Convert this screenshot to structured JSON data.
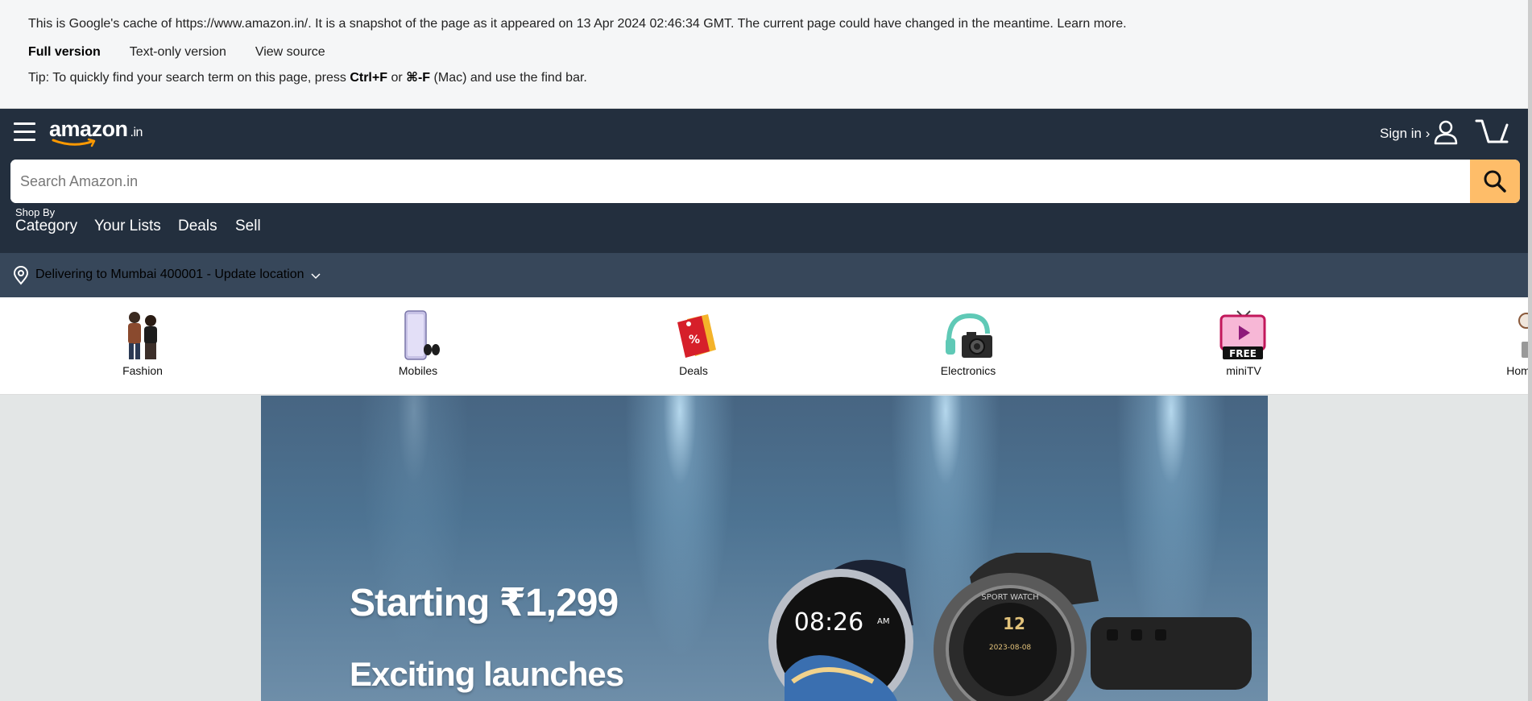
{
  "cache_banner": {
    "notice": "This is Google's cache of https://www.amazon.in/. It is a snapshot of the page as it appeared on 13 Apr 2024 02:46:34 GMT. The current page could have changed in the meantime.",
    "learn_more": "Learn more.",
    "versions": [
      "Full version",
      "Text-only version",
      "View source"
    ],
    "tip_prefix": "Tip: To quickly find your search term on this page, press",
    "tip_key1": "Ctrl+F",
    "tip_or": "or",
    "tip_key2": "⌘-F",
    "tip_suffix": "(Mac) and use the find bar."
  },
  "header": {
    "logo_text": "amazon",
    "logo_tld": ".in",
    "signin_label": "Sign in ›",
    "search_placeholder": "Search Amazon.in"
  },
  "subnav": {
    "shop_by": "Shop By",
    "items": [
      "Category",
      "Your Lists",
      "Deals",
      "Sell"
    ]
  },
  "delivery": {
    "text": "Delivering to Mumbai 400001 - Update location"
  },
  "categories": [
    {
      "label": "Fashion",
      "icon": "fashion-icon"
    },
    {
      "label": "Mobiles",
      "icon": "mobile-phone-icon"
    },
    {
      "label": "Deals",
      "icon": "discount-tag-icon"
    },
    {
      "label": "Electronics",
      "icon": "camera-headphones-icon"
    },
    {
      "label": "miniTV",
      "icon": "tv-free-icon"
    },
    {
      "label": "Hom",
      "icon": "home-appliances-icon"
    }
  ],
  "minitv_badge": "FREE",
  "deals_badge": "%",
  "hero": {
    "title": "Starting ₹1,299",
    "subtitle": "Exciting launches",
    "watch_time": "08:26",
    "watch_ampm": "AM",
    "watch2_brand": "SPORT WATCH",
    "watch2_number": "12",
    "watch2_date": "2023-08-08"
  },
  "colors": {
    "nav_bg": "#232f3e",
    "deliver_bg": "#37475a",
    "search_button": "#febd69",
    "smile": "#f90"
  }
}
